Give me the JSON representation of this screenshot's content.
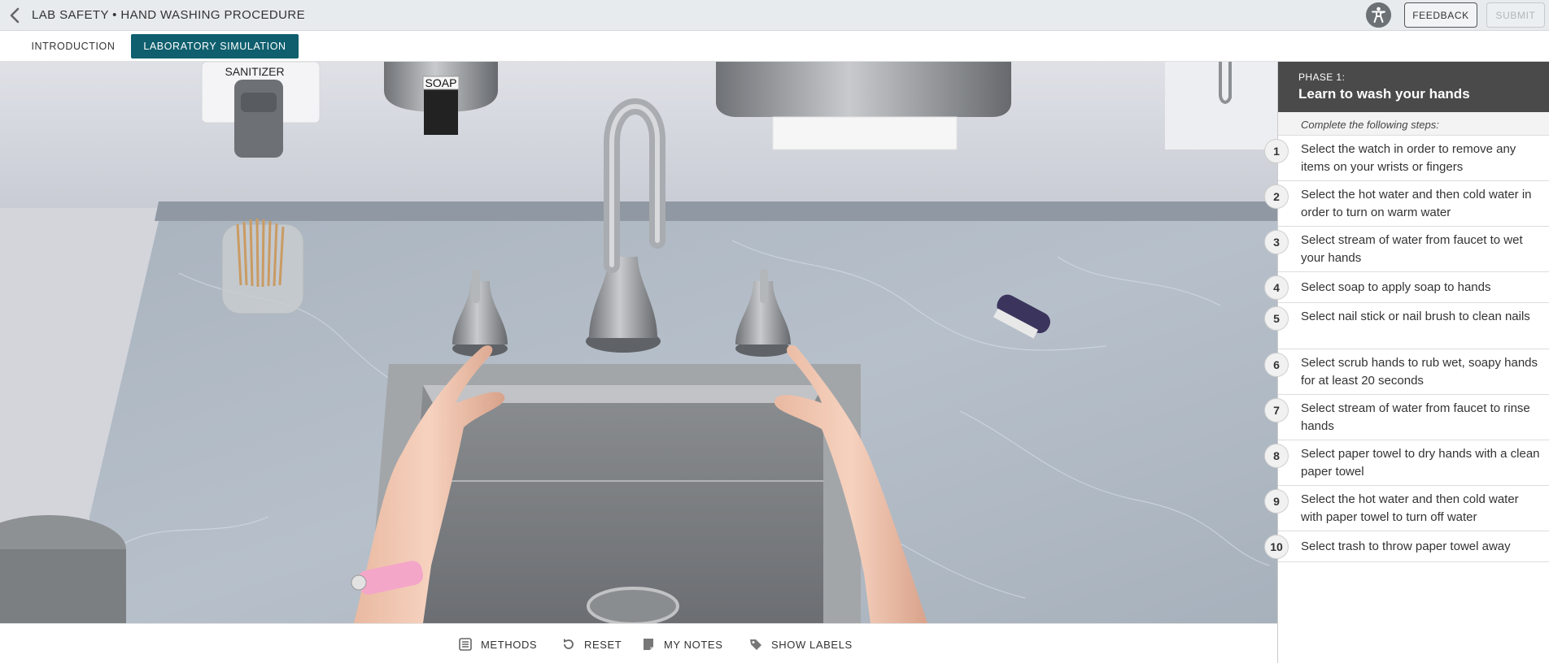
{
  "header": {
    "title": "LAB SAFETY • HAND WASHING PROCEDURE",
    "feedback_label": "FEEDBACK",
    "submit_label": "SUBMIT"
  },
  "tabs": [
    {
      "label": "INTRODUCTION",
      "active": false
    },
    {
      "label": "LABORATORY SIMULATION",
      "active": true
    }
  ],
  "scene": {
    "sanitizer_label": "SANITIZER",
    "soap_label": "SOAP"
  },
  "toolbar": {
    "methods_label": "METHODS",
    "reset_label": "RESET",
    "notes_label": "MY NOTES",
    "labels_label": "SHOW LABELS"
  },
  "panel": {
    "phase_label": "PHASE 1:",
    "phase_title": "Learn to wash your hands",
    "intro": "Complete the following steps:",
    "steps": [
      {
        "num": "1",
        "text": "Select the watch in order to remove any items on your wrists or fingers"
      },
      {
        "num": "2",
        "text": "Select the hot water and then cold water in order to turn on warm water"
      },
      {
        "num": "3",
        "text": "Select stream of water from faucet to wet your hands"
      },
      {
        "num": "4",
        "text": "Select soap to apply soap to hands"
      },
      {
        "num": "5",
        "text": "Select nail stick or nail brush to clean nails"
      },
      {
        "num": "6",
        "text": "Select scrub hands to rub wet, soapy hands for at least 20 seconds"
      },
      {
        "num": "7",
        "text": "Select stream of water from faucet to rinse hands"
      },
      {
        "num": "8",
        "text": "Select paper towel to dry hands with a clean paper towel"
      },
      {
        "num": "9",
        "text": "Select the hot water and then cold water with paper towel to turn off water"
      },
      {
        "num": "10",
        "text": "Select trash to throw paper towel away"
      }
    ]
  },
  "colors": {
    "accent": "#0f5f6e",
    "phase_header": "#4a4a4a",
    "watch_band": "#f4a6c8"
  }
}
